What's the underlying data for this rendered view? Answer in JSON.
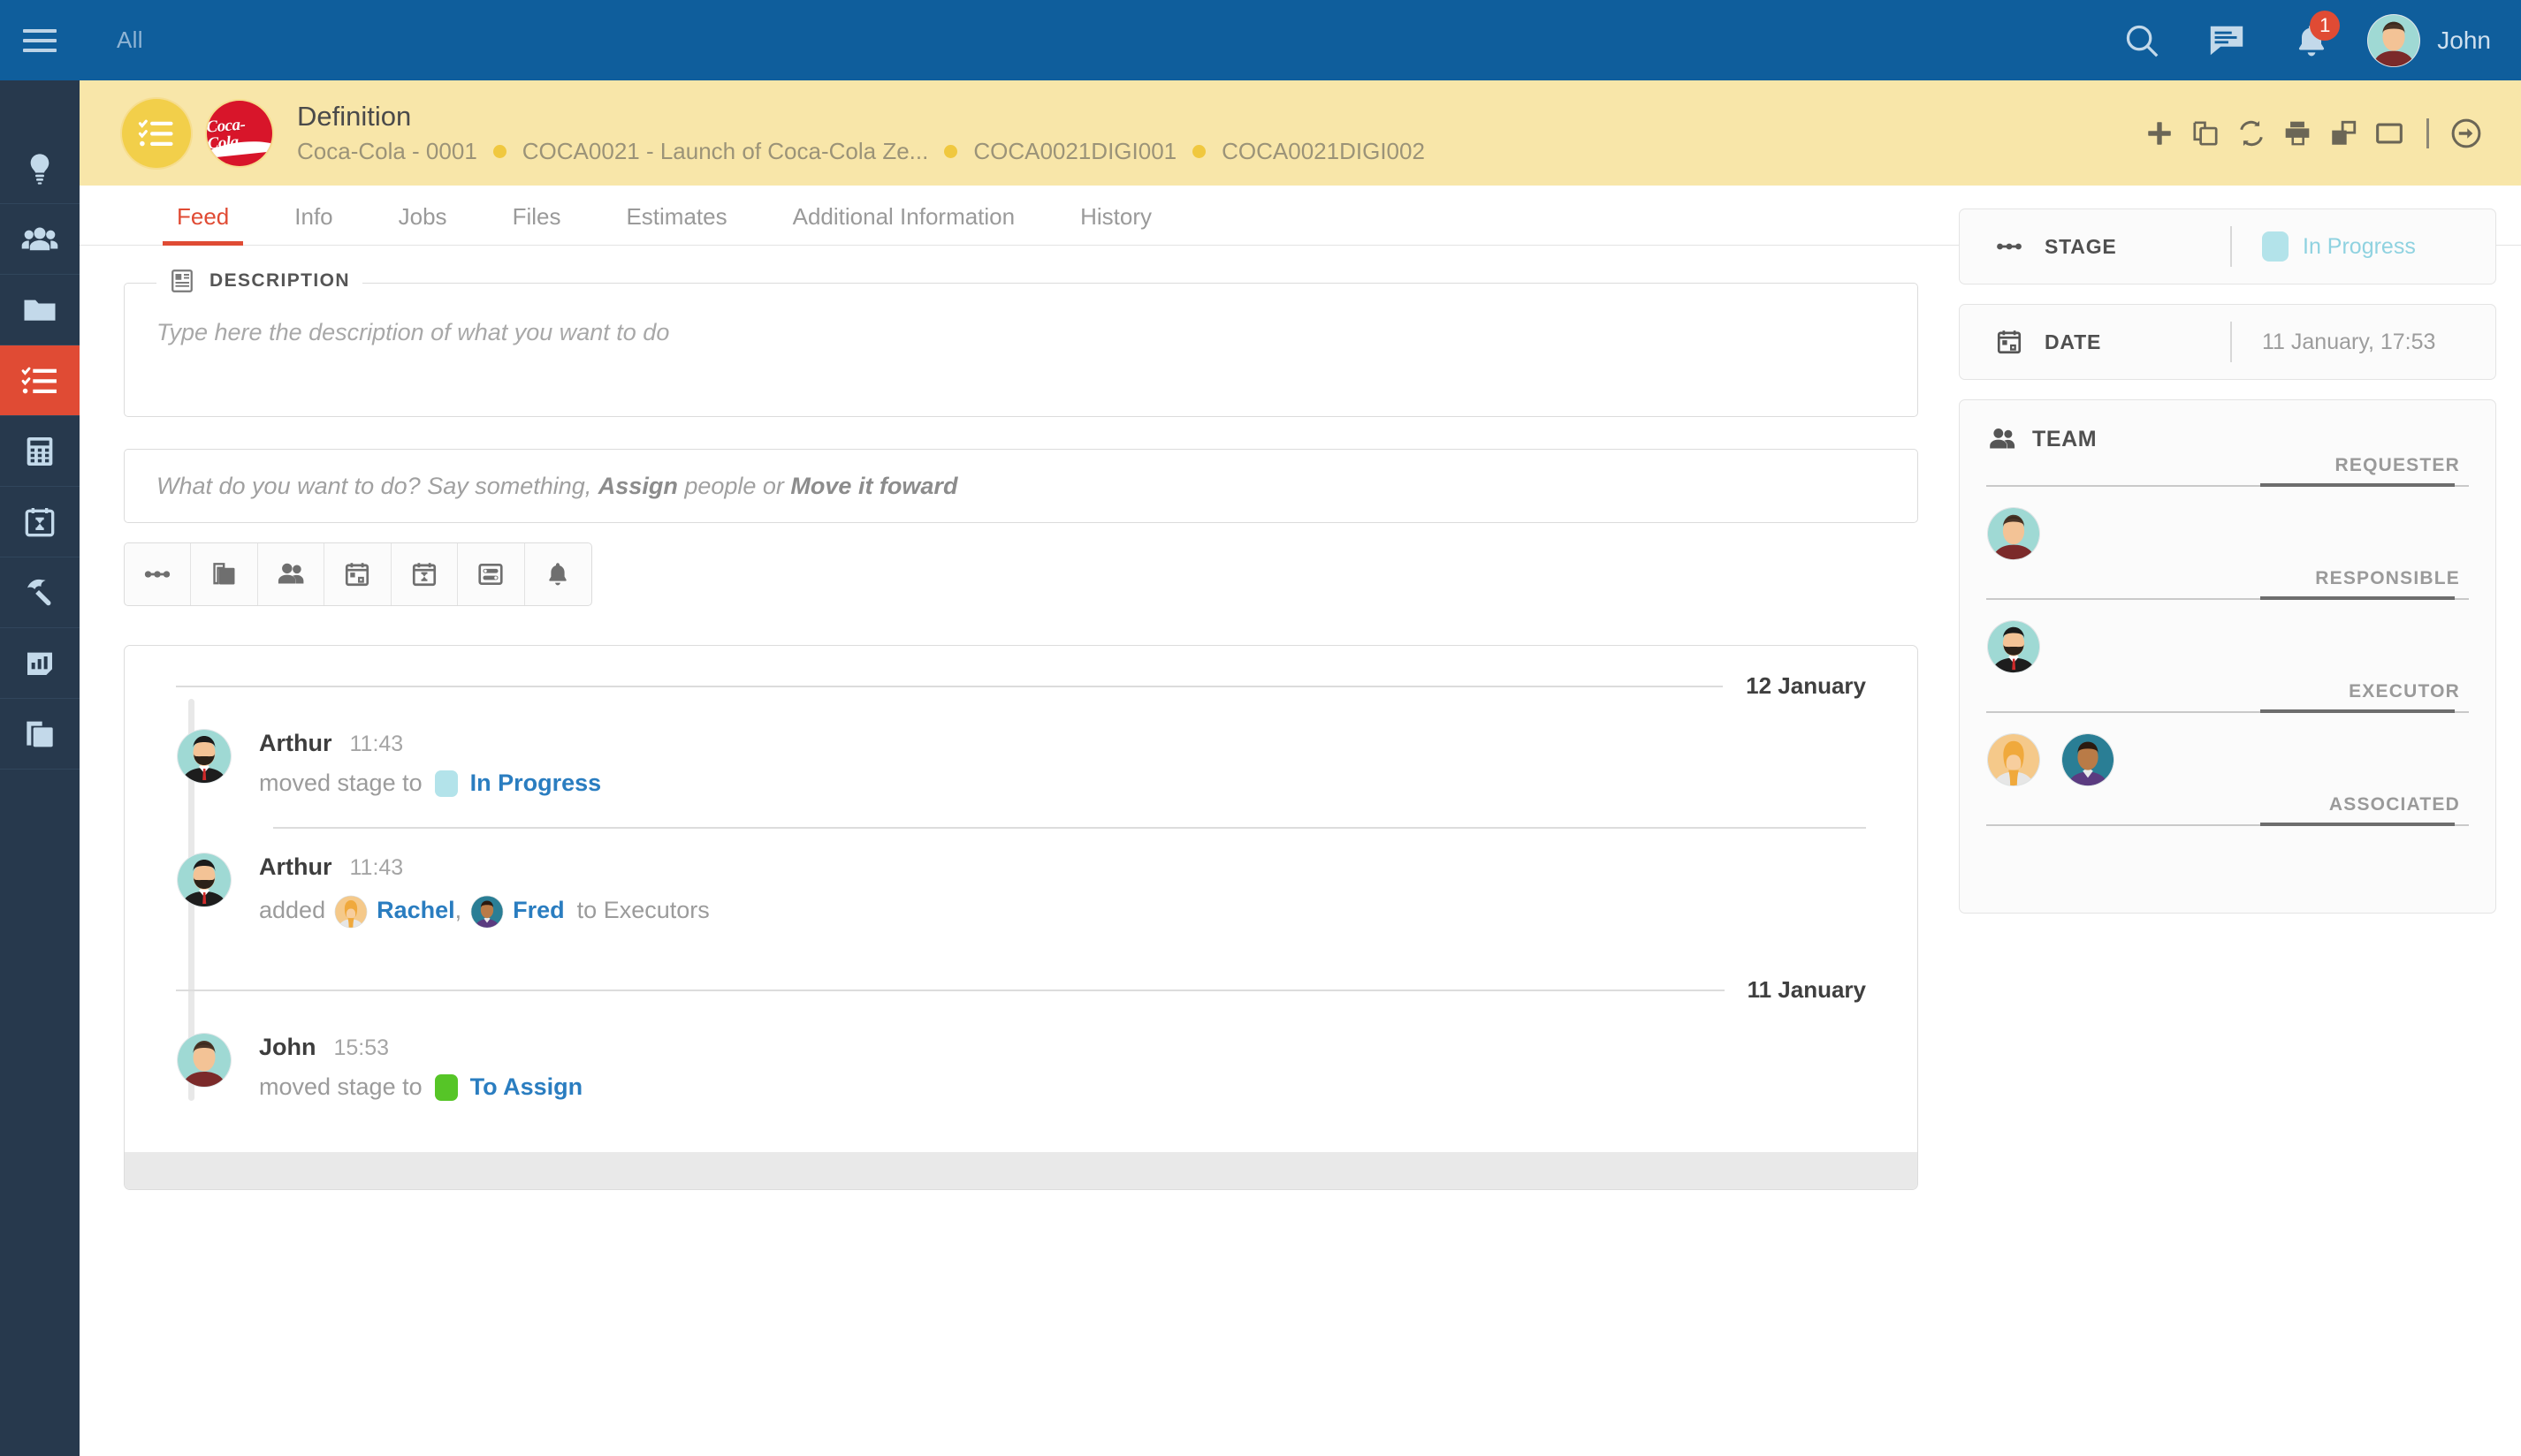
{
  "topbar": {
    "menu_icon": "hamburger-icon",
    "scope_label": "All",
    "search_icon": "search-icon",
    "chat_icon": "chat-icon",
    "notifications_icon": "bell-icon",
    "notifications_count": "1",
    "user_name": "John",
    "bg_color": "#0f5e9c"
  },
  "rail": {
    "items": [
      {
        "icon": "lightbulb-icon",
        "name": "ideas",
        "active": false
      },
      {
        "icon": "people-icon",
        "name": "clients",
        "active": false
      },
      {
        "icon": "folder-icon",
        "name": "projects",
        "active": false
      },
      {
        "icon": "checklist-icon",
        "name": "tasks",
        "active": true
      },
      {
        "icon": "calculator-icon",
        "name": "budget",
        "active": false
      },
      {
        "icon": "calendar-deadline-icon",
        "name": "schedule",
        "active": false
      },
      {
        "icon": "umbrella-icon",
        "name": "campaigns",
        "active": false
      },
      {
        "icon": "bar-chart-icon",
        "name": "reports",
        "active": false
      },
      {
        "icon": "copy-icon",
        "name": "library",
        "active": false
      }
    ],
    "bg_color": "#27394d",
    "active_color": "#e04b34"
  },
  "entity_header": {
    "bg_color": "#f8e6a9",
    "type_icon": "checklist-icon",
    "brand_logo": "coca-cola-logo",
    "brand_text": "Coca-Cola",
    "title": "Definition",
    "breadcrumbs": [
      "Coca-Cola - 0001",
      "COCA0021 - Launch of Coca-Cola Ze...",
      "COCA0021DIGI001",
      "COCA0021DIGI002"
    ],
    "actions": [
      {
        "icon": "plus-icon",
        "name": "add"
      },
      {
        "icon": "copy-icon",
        "name": "duplicate"
      },
      {
        "icon": "refresh-icon",
        "name": "refresh"
      },
      {
        "icon": "print-icon",
        "name": "print"
      },
      {
        "icon": "layers-icon",
        "name": "layers"
      },
      {
        "icon": "window-icon",
        "name": "window"
      },
      {
        "icon": "arrow-right-circle-icon",
        "name": "advance"
      }
    ]
  },
  "tabs": [
    {
      "label": "Feed",
      "active": true
    },
    {
      "label": "Info",
      "active": false
    },
    {
      "label": "Jobs",
      "active": false
    },
    {
      "label": "Files",
      "active": false
    },
    {
      "label": "Estimates",
      "active": false
    },
    {
      "label": "Additional Information",
      "active": false
    },
    {
      "label": "History",
      "active": false
    }
  ],
  "description": {
    "legend": "DESCRIPTION",
    "legend_icon": "document-icon",
    "placeholder": "Type here the description of what you want to do",
    "value": ""
  },
  "composer": {
    "placeholder_start": "What do you want to do? Say something, ",
    "placeholder_bold1": "Assign",
    "placeholder_mid": " people or ",
    "placeholder_bold2": "Move it foward",
    "value": "",
    "actions": [
      {
        "icon": "stage-flow-icon",
        "name": "change-stage"
      },
      {
        "icon": "copy-icon",
        "name": "attach-document"
      },
      {
        "icon": "people-icon",
        "name": "assign-people"
      },
      {
        "icon": "calendar-icon",
        "name": "set-date"
      },
      {
        "icon": "calendar-deadline-icon",
        "name": "set-deadline"
      },
      {
        "icon": "toggle-settings-icon",
        "name": "options"
      },
      {
        "icon": "bell-icon",
        "name": "notify"
      }
    ]
  },
  "feed": {
    "groups": [
      {
        "date": "12 January",
        "events": [
          {
            "author": "Arthur",
            "avatar": "man-beard-suit",
            "time": "11:43",
            "action_prefix": "moved stage to",
            "kind": "stage",
            "stage_label": "In Progress",
            "stage_color": "#b3e3ea",
            "action_suffix": ""
          },
          {
            "author": "Arthur",
            "avatar": "man-beard-suit",
            "time": "11:43",
            "action_prefix": "added",
            "kind": "assign",
            "people": [
              {
                "name": "Rachel",
                "avatar": "woman-blonde"
              },
              {
                "name": "Fred",
                "avatar": "man-purple-suit"
              }
            ],
            "action_suffix": "to Executors"
          }
        ]
      },
      {
        "date": "11 January",
        "events": [
          {
            "author": "John",
            "avatar": "man-brown-hair",
            "time": "15:53",
            "action_prefix": "moved stage to",
            "kind": "stage",
            "stage_label": "To Assign",
            "stage_color": "#56c527",
            "action_suffix": ""
          }
        ]
      }
    ]
  },
  "right_panel": {
    "stage": {
      "icon": "stage-flow-icon",
      "label": "STAGE",
      "value": "In Progress",
      "color": "#8fd2e0",
      "chip_color": "#b3e3ea"
    },
    "date": {
      "icon": "calendar-icon",
      "label": "DATE",
      "value": "11 January, 17:53"
    },
    "team": {
      "icon": "people-icon",
      "label": "TEAM",
      "roles": [
        {
          "label": "REQUESTER",
          "members": [
            {
              "avatar": "man-brown-hair"
            }
          ]
        },
        {
          "label": "RESPONSIBLE",
          "members": [
            {
              "avatar": "man-beard-suit"
            }
          ]
        },
        {
          "label": "EXECUTOR",
          "members": [
            {
              "avatar": "woman-blonde"
            },
            {
              "avatar": "man-purple-suit"
            }
          ]
        },
        {
          "label": "ASSOCIATED",
          "members": []
        }
      ]
    }
  }
}
